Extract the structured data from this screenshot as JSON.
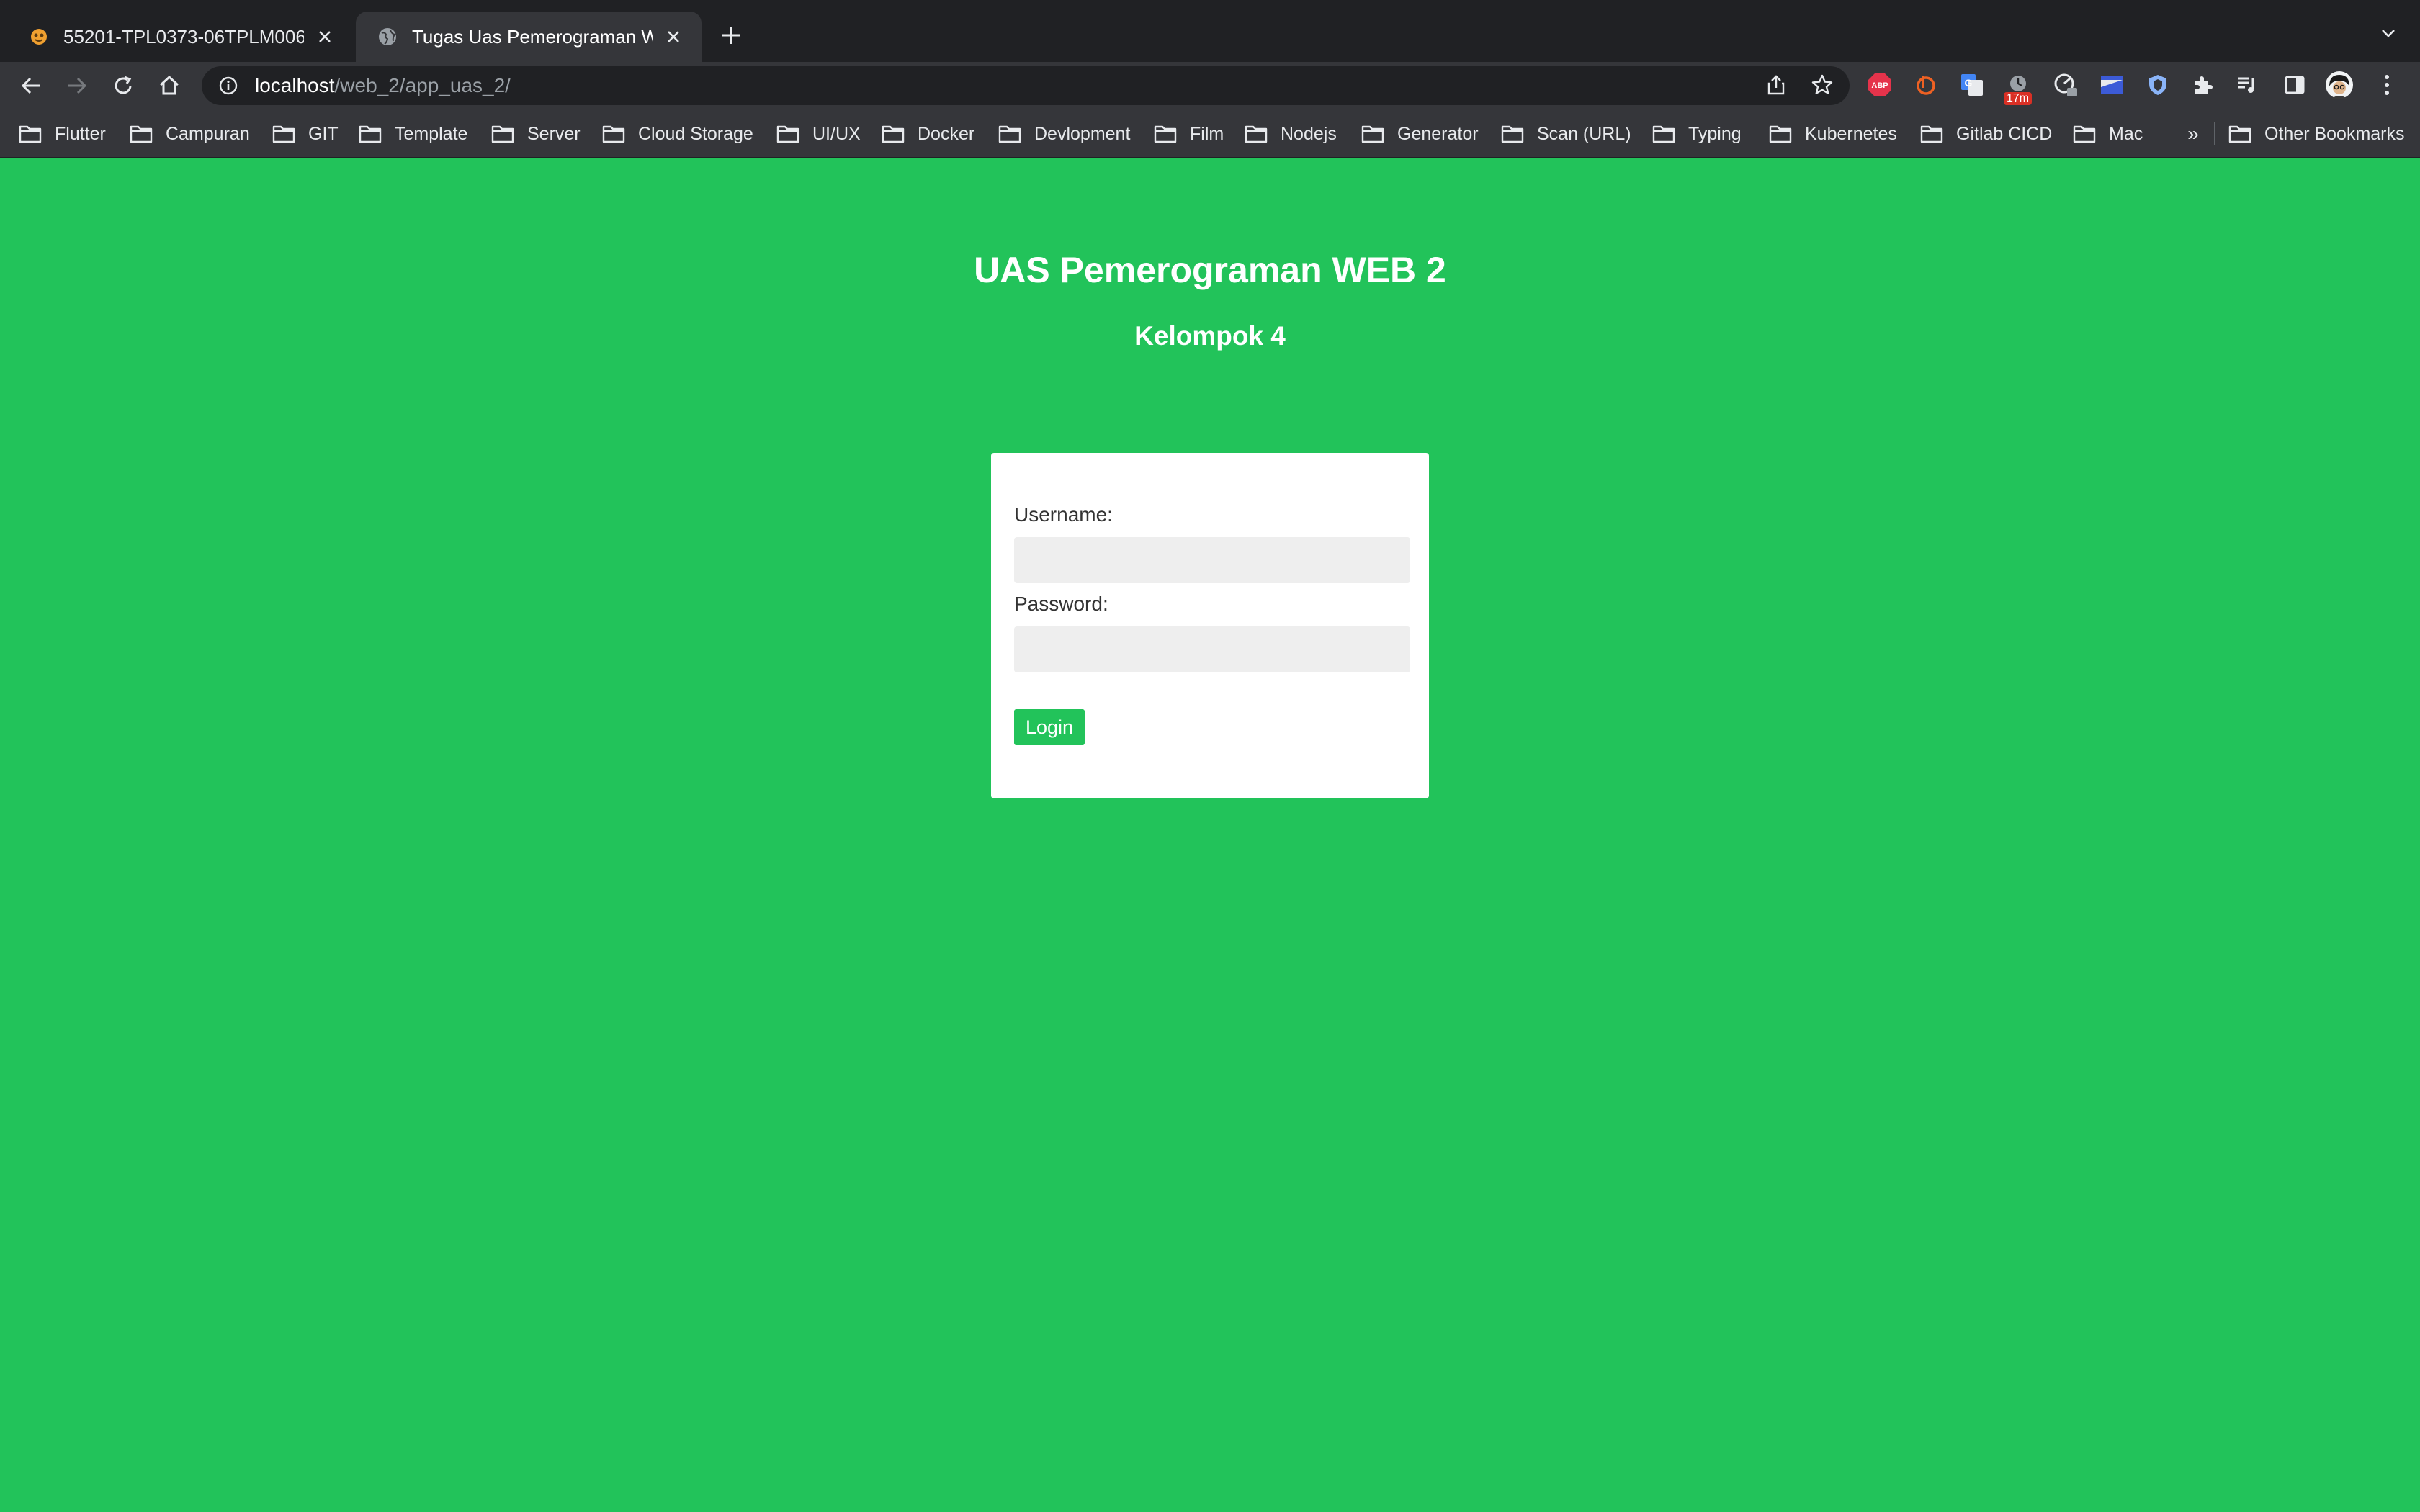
{
  "tabs": [
    {
      "title": "55201-TPL0373-06TPLM006-",
      "favicon": "moodle-icon"
    },
    {
      "title": "Tugas Uas Pemerograman WEB",
      "favicon": "globe-icon"
    }
  ],
  "omnibox": {
    "host": "localhost",
    "path": "/web_2/app_uas_2/"
  },
  "extensions": {
    "abp_label": "ABP",
    "timer_badge": "17m"
  },
  "bookmarks": [
    "Flutter",
    "Campuran",
    "GIT",
    "Template",
    "Server",
    "Cloud Storage",
    "UI/UX",
    "Docker",
    "Devlopment",
    "Film",
    "Nodejs",
    "Generator",
    "Scan (URL)",
    "Typing",
    "Kubernetes",
    "Gitlab CICD",
    "Mac"
  ],
  "bookmarks_overflow": "»",
  "other_bookmarks": "Other Bookmarks",
  "page": {
    "title": "UAS Pemerograman WEB 2",
    "subtitle": "Kelompok 4",
    "form": {
      "username_label": "Username:",
      "password_label": "Password:",
      "username_value": "",
      "password_value": "",
      "login_label": "Login"
    }
  },
  "colors": {
    "page_background": "#22c35a",
    "button": "#22c35a",
    "card": "#ffffff",
    "input": "#eeeeee"
  }
}
